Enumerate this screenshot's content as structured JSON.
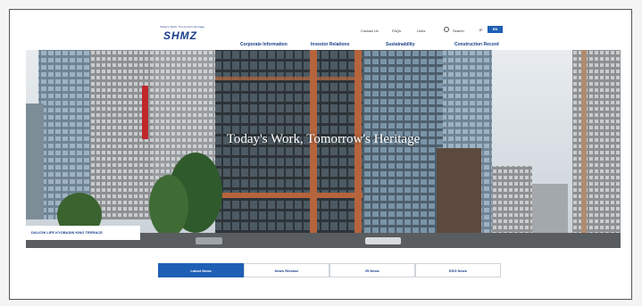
{
  "header": {
    "logo_tagline": "Today's Work, Tomorrow's Heritage",
    "logo_text": "SHMZ",
    "utility_links": [
      "Contact Us",
      "FAQs",
      "Links",
      "Search"
    ],
    "lang_jp": "JP",
    "lang_en": "EN",
    "nav": [
      "Corporate Information",
      "Investor Relations",
      "Sustainability",
      "Construction Record"
    ]
  },
  "hero": {
    "title": "Today's Work, Tomorrow's Heritage",
    "caption": "DAI-ICHI LIFE KYOBASHI KINO TERRACE"
  },
  "news_tabs": [
    {
      "label": "Latest News",
      "active": true
    },
    {
      "label": "News Release",
      "active": false
    },
    {
      "label": "IR News",
      "active": false
    },
    {
      "label": "ESG News",
      "active": false
    }
  ],
  "colors": {
    "brand": "#1a3f8a",
    "accent": "#1e5fb5"
  }
}
